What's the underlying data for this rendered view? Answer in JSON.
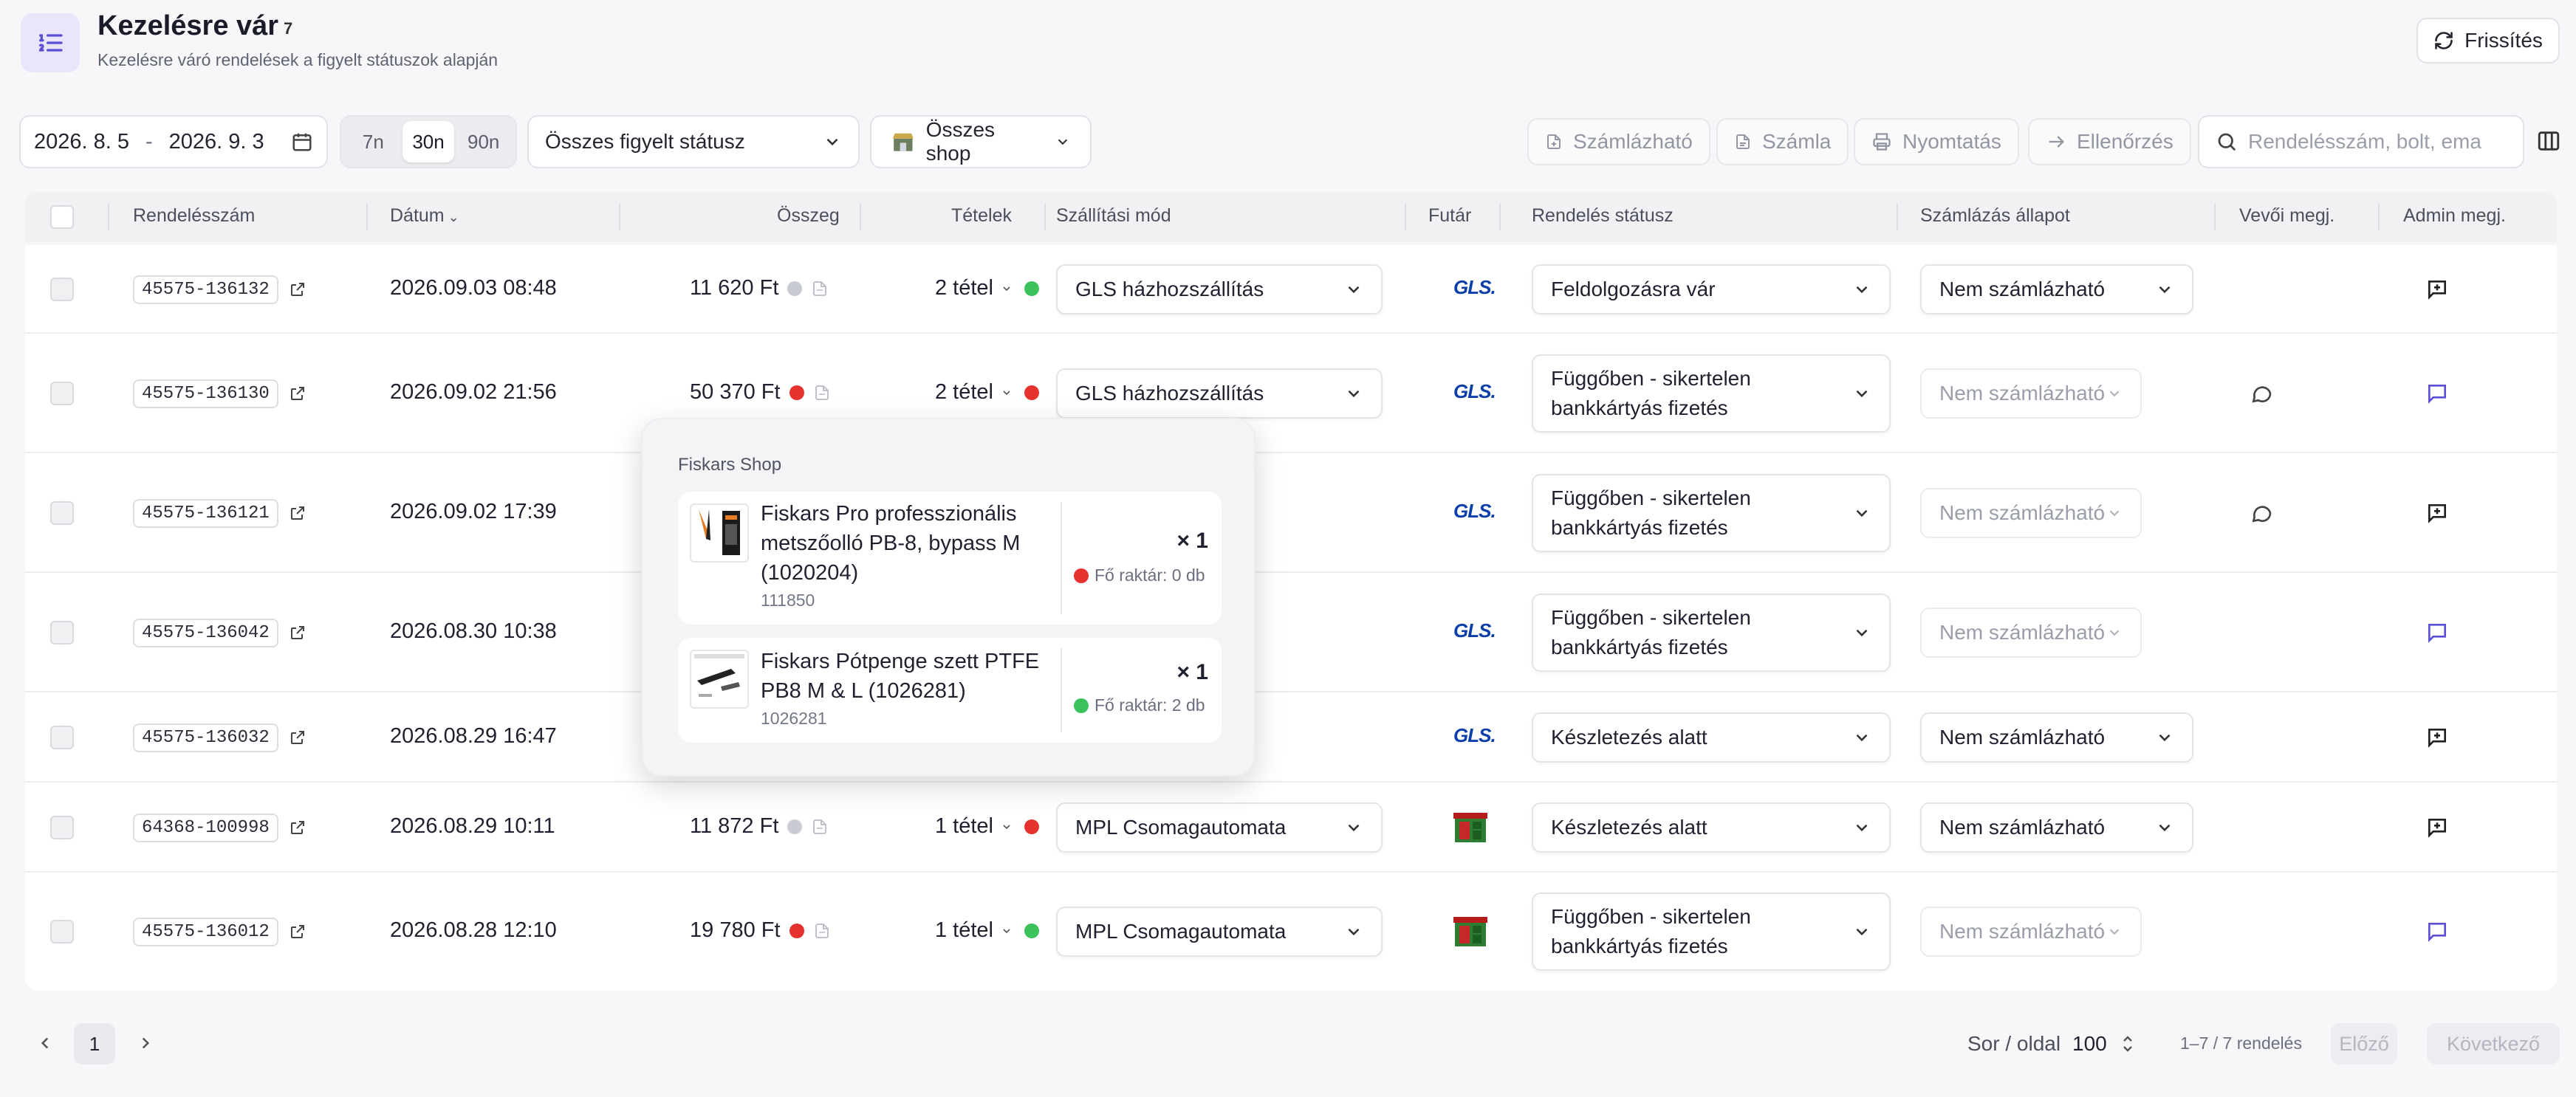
{
  "header": {
    "title": "Kezelésre vár",
    "count": "7",
    "subtitle": "Kezelésre váró rendelések a figyelt státuszok alapján",
    "refresh_label": "Frissítés"
  },
  "filters": {
    "date_from": "2026. 8. 5",
    "date_sep": "-",
    "date_to": "2026. 9. 3",
    "ranges": [
      "7n",
      "30n",
      "90n"
    ],
    "active_range": "30n",
    "status_select": "Összes figyelt státusz",
    "shop_select": "Összes shop",
    "actions": [
      "Számlázható",
      "Számla",
      "Nyomtatás",
      "Ellenőrzés"
    ],
    "search_placeholder": "Rendelésszám, bolt, ema"
  },
  "columns": [
    "Rendelésszám",
    "Dátum",
    "Összeg",
    "Tételek",
    "Szállítási mód",
    "Futár",
    "Rendelés státusz",
    "Számlázás állapot",
    "Vevői megj.",
    "Admin megj."
  ],
  "rows": [
    {
      "order": "45575-136132",
      "date": "2026.09.03 08:48",
      "amount": "11 620 Ft",
      "pay_color": "#c9cbd2",
      "items": "2 tétel",
      "items_color": "#3cc25a",
      "shipping": "GLS házhozszállítás",
      "courier": "GLS",
      "status": "Feldolgozásra vár",
      "billing": "Nem számlázható",
      "billing_dim": false,
      "customer_note": false,
      "admin_note": "add"
    },
    {
      "order": "45575-136130",
      "date": "2026.09.02 21:56",
      "amount": "50 370 Ft",
      "pay_color": "#e5322e",
      "items": "2 tétel",
      "items_color": "#e5322e",
      "shipping": "GLS házhozszállítás",
      "courier": "GLS",
      "status": "Függőben - sikertelen bankkártyás fizetés",
      "billing": "Nem számlázható",
      "billing_dim": true,
      "customer_note": true,
      "admin_note": "note"
    },
    {
      "order": "45575-136121",
      "date": "2026.09.02 17:39",
      "amount": "",
      "pay_color": "",
      "items": "",
      "items_color": "",
      "shipping": "",
      "courier": "GLS",
      "status": "Függőben - sikertelen bankkártyás fizetés",
      "billing": "Nem számlázható",
      "billing_dim": true,
      "customer_note": true,
      "admin_note": "add"
    },
    {
      "order": "45575-136042",
      "date": "2026.08.30 10:38",
      "amount": "",
      "pay_color": "",
      "items": "",
      "items_color": "",
      "shipping": "",
      "courier": "GLS",
      "status": "Függőben - sikertelen bankkártyás fizetés",
      "billing": "Nem számlázható",
      "billing_dim": true,
      "customer_note": false,
      "admin_note": "note"
    },
    {
      "order": "45575-136032",
      "date": "2026.08.29 16:47",
      "amount": "",
      "pay_color": "",
      "items": "",
      "items_color": "",
      "shipping": "",
      "courier": "GLS",
      "status": "Készletezés alatt",
      "billing": "Nem számlázható",
      "billing_dim": false,
      "customer_note": false,
      "admin_note": "add"
    },
    {
      "order": "64368-100998",
      "date": "2026.08.29 10:11",
      "amount": "11 872 Ft",
      "pay_color": "#c9cbd2",
      "items": "1 tétel",
      "items_color": "#e5322e",
      "shipping": "MPL Csomagautomata",
      "courier": "MPL",
      "status": "Készletezés alatt",
      "billing": "Nem számlázható",
      "billing_dim": false,
      "customer_note": false,
      "admin_note": "add"
    },
    {
      "order": "45575-136012",
      "date": "2026.08.28 12:10",
      "amount": "19 780 Ft",
      "pay_color": "#e5322e",
      "items": "1 tétel",
      "items_color": "#3cc25a",
      "shipping": "MPL Csomagautomata",
      "courier": "MPL",
      "status": "Függőben - sikertelen bankkártyás fizetés",
      "billing": "Nem számlázható",
      "billing_dim": true,
      "customer_note": false,
      "admin_note": "note"
    }
  ],
  "popover": {
    "shop": "Fiskars Shop",
    "items": [
      {
        "name": "Fiskars Pro professzionális metszőolló PB-8, bypass M (1020204)",
        "sku": "111850",
        "qty": "× 1",
        "stock": "Fő raktár: 0 db",
        "stock_color": "#e5322e"
      },
      {
        "name": "Fiskars Pótpenge szett PTFE PB8 M & L (1026281)",
        "sku": "1026281",
        "qty": "× 1",
        "stock": "Fő raktár: 2 db",
        "stock_color": "#3cc25a"
      }
    ]
  },
  "footer": {
    "page": "1",
    "rows_per_page_label": "Sor / oldal",
    "rows_per_page": "100",
    "range": "1–7 / 7 rendelés",
    "prev": "Előző",
    "next": "Következő"
  },
  "colors": {
    "accent": "#5b4fd6",
    "danger": "#e5322e",
    "success": "#3cc25a",
    "gls": "#0a3ea8"
  }
}
